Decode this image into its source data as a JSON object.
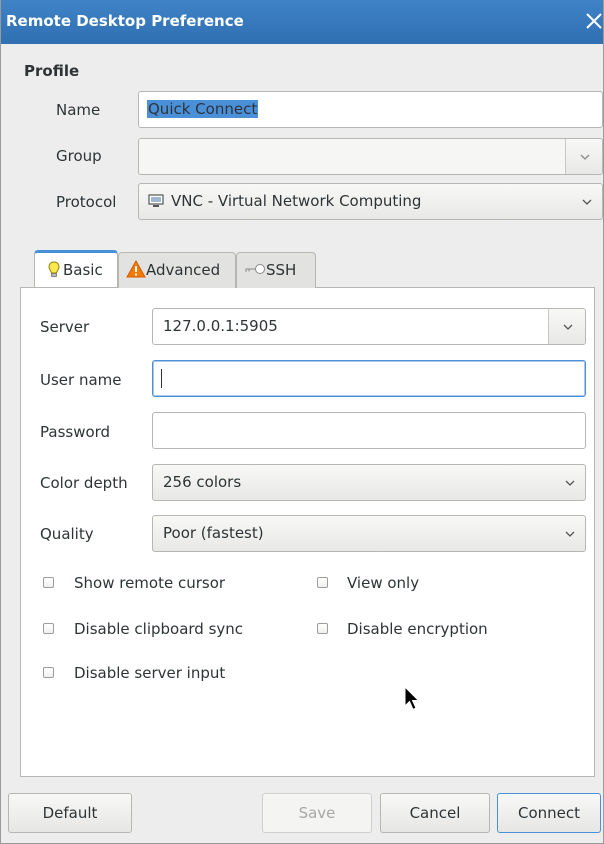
{
  "window": {
    "title": "Remote Desktop Preference"
  },
  "profile": {
    "section_title": "Profile",
    "name_label": "Name",
    "name_value": "Quick Connect",
    "group_label": "Group",
    "group_value": "",
    "protocol_label": "Protocol",
    "protocol_value": "VNC - Virtual Network Computing"
  },
  "tabs": [
    {
      "label": "Basic",
      "icon": "bulb-icon",
      "active": true
    },
    {
      "label": "Advanced",
      "icon": "warning-icon",
      "active": false
    },
    {
      "label": "SSH",
      "icon": "key-icon",
      "active": false
    }
  ],
  "basic": {
    "server_label": "Server",
    "server_value": "127.0.0.1:5905",
    "username_label": "User name",
    "username_value": "",
    "password_label": "Password",
    "password_value": "",
    "color_depth_label": "Color depth",
    "color_depth_value": "256 colors",
    "quality_label": "Quality",
    "quality_value": "Poor (fastest)",
    "checkboxes": [
      {
        "label": "Show remote cursor",
        "checked": false
      },
      {
        "label": "View only",
        "checked": false
      },
      {
        "label": "Disable clipboard sync",
        "checked": false
      },
      {
        "label": "Disable encryption",
        "checked": false
      },
      {
        "label": "Disable server input",
        "checked": false
      }
    ]
  },
  "buttons": {
    "default": "Default",
    "save": "Save",
    "cancel": "Cancel",
    "connect": "Connect"
  },
  "colors": {
    "titlebar": "#3479bd",
    "selection": "#4a90d9",
    "warning": "#f57900"
  }
}
